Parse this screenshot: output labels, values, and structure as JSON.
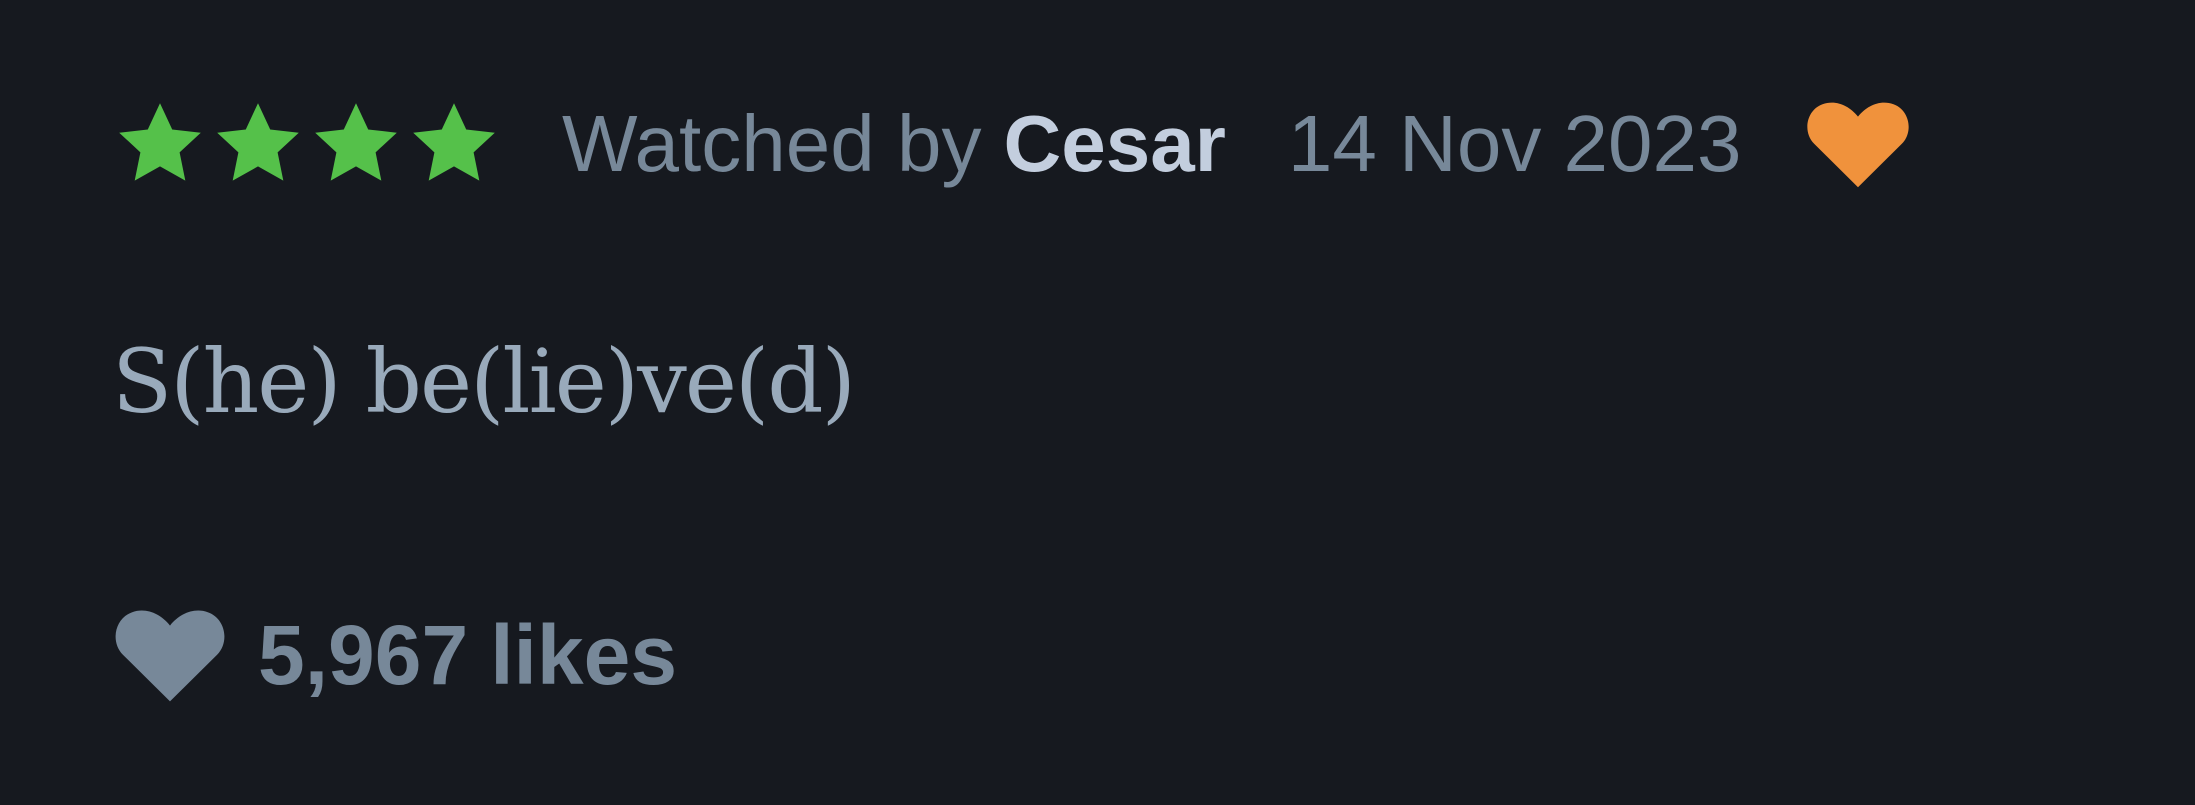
{
  "review": {
    "rating_stars": 4,
    "rating_max": 5,
    "star_color": "#55c14a",
    "watched_label": "Watched by",
    "author": "Cesar",
    "date": "14 Nov 2023",
    "liked_by_author": true,
    "liked_icon": "heart-icon",
    "liked_color": "#f0923c",
    "body": "S(he) be(lie)ve(d)",
    "likes_count": "5,967",
    "likes_label": "likes",
    "likes_icon": "heart-icon"
  }
}
